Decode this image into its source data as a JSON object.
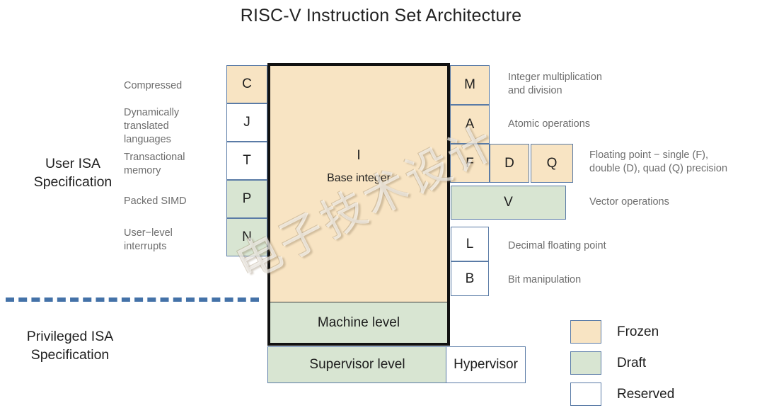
{
  "title": "RISC-V Instruction Set Architecture",
  "watermark": "电子技术设计",
  "sections": {
    "user": "User ISA\nSpecification",
    "user_line1": "User ISA",
    "user_line2": "Specification",
    "privileged_line1": "Privileged ISA",
    "privileged_line2": "Specification"
  },
  "core": {
    "letter": "I",
    "description": "Base integer",
    "machine_level": "Machine level",
    "supervisor_level": "Supervisor level",
    "hypervisor": "Hypervisor"
  },
  "left_extensions": [
    {
      "letter": "C",
      "status": "Frozen",
      "label": "Compressed"
    },
    {
      "letter": "J",
      "status": "Reserved",
      "label": "Dynamically\ntranslated\nlanguages",
      "label_l1": "Dynamically",
      "label_l2": "translated",
      "label_l3": "languages"
    },
    {
      "letter": "T",
      "status": "Reserved",
      "label": "Transactional\nmemory",
      "label_l1": "Transactional",
      "label_l2": "memory"
    },
    {
      "letter": "P",
      "status": "Draft",
      "label": "Packed SIMD"
    },
    {
      "letter": "N",
      "status": "Draft",
      "label": "User−level\ninterrupts",
      "label_l1": "User−level",
      "label_l2": "interrupts"
    }
  ],
  "right_extensions": [
    {
      "letter": "M",
      "status": "Frozen",
      "label_l1": "Integer multiplication",
      "label_l2": "and division"
    },
    {
      "letter": "A",
      "status": "Frozen",
      "label_l1": "Atomic operations",
      "label_l2": ""
    },
    {
      "letter": "F",
      "status": "Frozen",
      "label_l1": "Floating point − single (F),",
      "label_l2": "double (D), quad (Q) precision"
    },
    {
      "letter": "D",
      "status": "Frozen"
    },
    {
      "letter": "Q",
      "status": "Frozen"
    },
    {
      "letter": "V",
      "status": "Draft",
      "label_l1": "Vector operations",
      "label_l2": ""
    },
    {
      "letter": "L",
      "status": "Reserved",
      "label_l1": "Decimal floating point",
      "label_l2": ""
    },
    {
      "letter": "B",
      "status": "Reserved",
      "label_l1": "Bit manipulation",
      "label_l2": ""
    }
  ],
  "legend": [
    {
      "label": "Frozen",
      "color": "#f8e4c3"
    },
    {
      "label": "Draft",
      "color": "#d8e5d2"
    },
    {
      "label": "Reserved",
      "color": "#ffffff"
    }
  ],
  "colors": {
    "frozen": "#f8e4c3",
    "draft": "#d8e5d2",
    "reserved": "#ffffff",
    "box_border": "#5a7ba6",
    "core_border": "#111111",
    "divider": "#4472a8",
    "note_text": "#6e6e6e"
  }
}
